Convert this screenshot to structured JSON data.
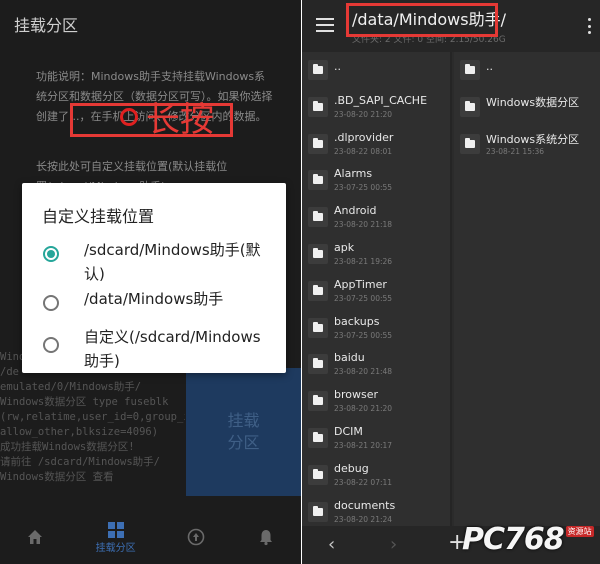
{
  "left": {
    "title": "挂载分区",
    "description": "功能说明：Mindows助手支持挂载Windows系统分区和数据分区（数据分区可写）。如果你选择创建了...，在手机上访问、修改分区内的数据。",
    "hint": "长按此处可自定义挂载位置(默认挂载位置/sdcard/Mindows助手)",
    "annotation": "长按",
    "dialog": {
      "title": "自定义挂载位置",
      "options": [
        {
          "label": "/sdcard/Mindows助手(默认)",
          "checked": true
        },
        {
          "label": "/data/Mindows助手",
          "checked": false
        },
        {
          "label": "自定义(/sdcard/Mindows助手)",
          "checked": false
        }
      ]
    },
    "log_lines": [
      "Wind",
      "/de",
      "emulated/0/Mindows助手/",
      "Windows数据分区 type fuseblk",
      "(rw,relatime,user_id=0,group_id=0,",
      "allow_other,blksize=4096)",
      "成功挂载Windows数据分区!",
      "请前往 /sdcard/Mindows助手/",
      "Windows数据分区 查看"
    ],
    "mount_button": [
      "挂载",
      "分区"
    ],
    "nav": [
      {
        "icon": "home-icon",
        "label": ""
      },
      {
        "icon": "grid-icon",
        "label": "挂载分区"
      },
      {
        "icon": "upload-icon",
        "label": ""
      },
      {
        "icon": "bell-icon",
        "label": ""
      }
    ]
  },
  "right": {
    "path": "/data/Mindows助手/",
    "sub": "文件夹: 2 文件: 0 空间: 2.15/50.26G",
    "left_column": [
      {
        "name": "..",
        "date": ""
      },
      {
        "name": ".BD_SAPI_CACHE",
        "date": "23-08-20 21:20"
      },
      {
        "name": ".dlprovider",
        "date": "23-08-22 08:01"
      },
      {
        "name": "Alarms",
        "date": "23-07-25 00:55"
      },
      {
        "name": "Android",
        "date": "23-08-20 21:18"
      },
      {
        "name": "apk",
        "date": "23-08-21 19:26"
      },
      {
        "name": "AppTimer",
        "date": "23-07-25 00:55"
      },
      {
        "name": "backups",
        "date": "23-07-25 00:55"
      },
      {
        "name": "baidu",
        "date": "23-08-20 21:48"
      },
      {
        "name": "browser",
        "date": "23-08-20 21:20"
      },
      {
        "name": "DCIM",
        "date": "23-08-21 20:17"
      },
      {
        "name": "debug",
        "date": "23-08-22 07:11"
      },
      {
        "name": "documents",
        "date": "23-08-20 21:24"
      }
    ],
    "right_column": [
      {
        "name": "..",
        "date": ""
      },
      {
        "name": "Windows数据分区",
        "date": ""
      },
      {
        "name": "Windows系统分区",
        "date": "23-08-21 15:36"
      }
    ],
    "watermark": "PC768",
    "watermark_tag": "资源站"
  }
}
